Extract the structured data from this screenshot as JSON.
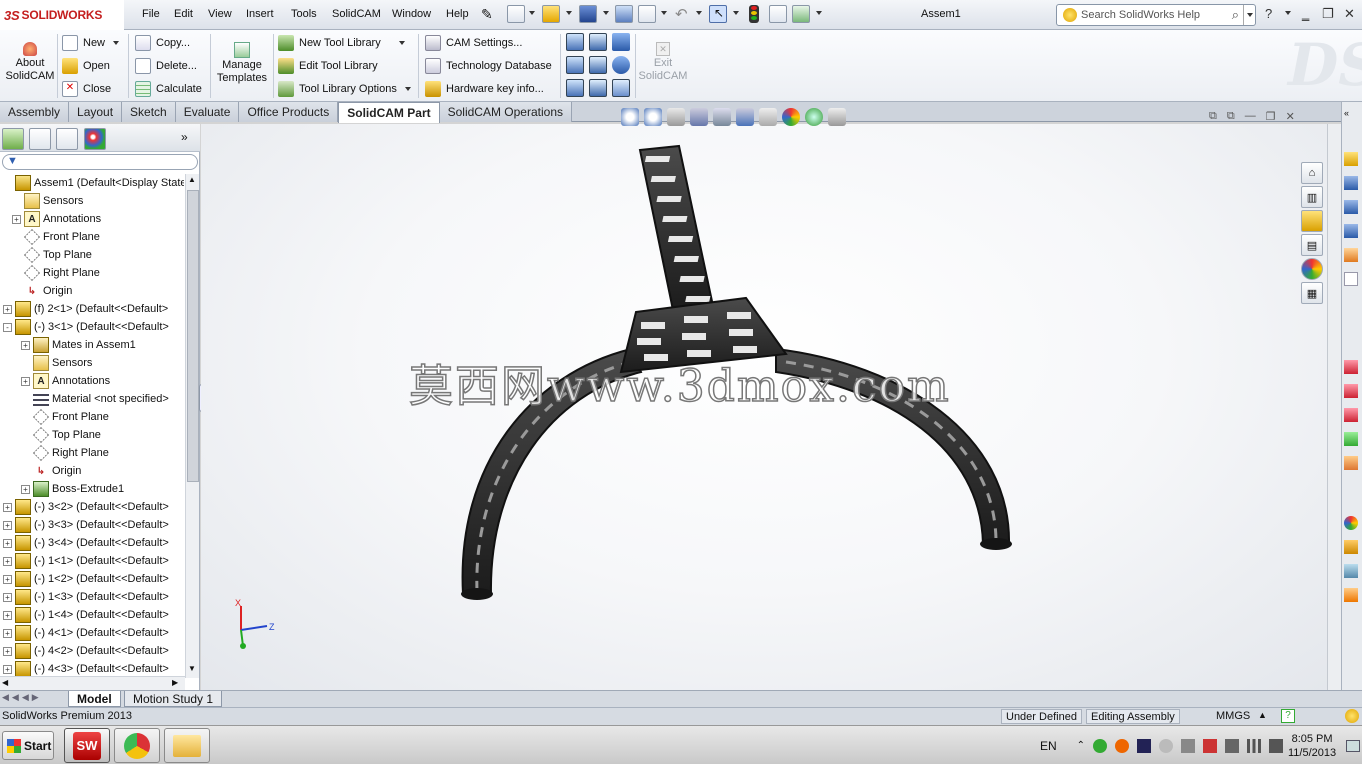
{
  "app": {
    "logo_ds": "3S",
    "logo_name": "SOLIDWORKS",
    "document_title": "Assem1"
  },
  "menu": [
    "File",
    "Edit",
    "View",
    "Insert",
    "Tools",
    "SolidCAM",
    "Window",
    "Help"
  ],
  "search": {
    "placeholder": "Search SolidWorks Help"
  },
  "command_manager": {
    "about": {
      "label1": "About",
      "label2": "SolidCAM"
    },
    "file_group": [
      "New",
      "Open",
      "Close"
    ],
    "edit_group": [
      "Copy...",
      "Delete...",
      "Calculate"
    ],
    "manage_templates": {
      "label1": "Manage",
      "label2": "Templates"
    },
    "tool_group": [
      "New Tool Library",
      "Edit Tool Library",
      "Tool Library Options"
    ],
    "cam_group": [
      "CAM Settings...",
      "Technology Database",
      "Hardware key info..."
    ],
    "exit": {
      "label1": "Exit",
      "label2": "SolidCAM"
    }
  },
  "tabs": [
    {
      "label": "Assembly",
      "active": false
    },
    {
      "label": "Layout",
      "active": false
    },
    {
      "label": "Sketch",
      "active": false
    },
    {
      "label": "Evaluate",
      "active": false
    },
    {
      "label": "Office Products",
      "active": false
    },
    {
      "label": "SolidCAM Part",
      "active": true
    },
    {
      "label": "SolidCAM Operations",
      "active": false
    }
  ],
  "tree": [
    {
      "indent": 0,
      "exp": "",
      "icon": "assembly",
      "label": "Assem1  (Default<Display State-1"
    },
    {
      "indent": 1,
      "exp": "",
      "icon": "sensor",
      "label": "Sensors"
    },
    {
      "indent": 1,
      "exp": "+",
      "icon": "annotation",
      "label": "Annotations"
    },
    {
      "indent": 1,
      "exp": "",
      "icon": "plane",
      "label": "Front Plane"
    },
    {
      "indent": 1,
      "exp": "",
      "icon": "plane",
      "label": "Top Plane"
    },
    {
      "indent": 1,
      "exp": "",
      "icon": "plane",
      "label": "Right Plane"
    },
    {
      "indent": 1,
      "exp": "",
      "icon": "origin",
      "label": "Origin"
    },
    {
      "indent": 0,
      "exp": "+",
      "icon": "part",
      "label": "(f) 2<1> (Default<<Default>"
    },
    {
      "indent": 0,
      "exp": "-",
      "icon": "part",
      "label": "(-) 3<1> (Default<<Default>"
    },
    {
      "indent": 2,
      "exp": "+",
      "icon": "mates",
      "label": "Mates in Assem1"
    },
    {
      "indent": 2,
      "exp": "",
      "icon": "sensor",
      "label": "Sensors"
    },
    {
      "indent": 2,
      "exp": "+",
      "icon": "annotation",
      "label": "Annotations"
    },
    {
      "indent": 2,
      "exp": "",
      "icon": "material",
      "label": "Material <not specified>"
    },
    {
      "indent": 2,
      "exp": "",
      "icon": "plane",
      "label": "Front Plane"
    },
    {
      "indent": 2,
      "exp": "",
      "icon": "plane",
      "label": "Top Plane"
    },
    {
      "indent": 2,
      "exp": "",
      "icon": "plane",
      "label": "Right Plane"
    },
    {
      "indent": 2,
      "exp": "",
      "icon": "origin",
      "label": "Origin"
    },
    {
      "indent": 2,
      "exp": "+",
      "icon": "extrude",
      "label": "Boss-Extrude1"
    },
    {
      "indent": 0,
      "exp": "+",
      "icon": "part",
      "label": "(-) 3<2> (Default<<Default>"
    },
    {
      "indent": 0,
      "exp": "+",
      "icon": "part",
      "label": "(-) 3<3> (Default<<Default>"
    },
    {
      "indent": 0,
      "exp": "+",
      "icon": "part",
      "label": "(-) 3<4> (Default<<Default>"
    },
    {
      "indent": 0,
      "exp": "+",
      "icon": "part",
      "label": "(-) 1<1> (Default<<Default>"
    },
    {
      "indent": 0,
      "exp": "+",
      "icon": "part",
      "label": "(-) 1<2> (Default<<Default>"
    },
    {
      "indent": 0,
      "exp": "+",
      "icon": "part",
      "label": "(-) 1<3> (Default<<Default>"
    },
    {
      "indent": 0,
      "exp": "+",
      "icon": "part",
      "label": "(-) 1<4> (Default<<Default>"
    },
    {
      "indent": 0,
      "exp": "+",
      "icon": "part",
      "label": "(-) 4<1> (Default<<Default>"
    },
    {
      "indent": 0,
      "exp": "+",
      "icon": "part",
      "label": "(-) 4<2> (Default<<Default>"
    },
    {
      "indent": 0,
      "exp": "+",
      "icon": "part",
      "label": "(-) 4<3> (Default<<Default>"
    }
  ],
  "viewport": {
    "watermark": "莫西网www.3dmox.com",
    "triad_x": "X",
    "triad_z": "Z"
  },
  "bottom_tabs": [
    "Model",
    "Motion Study 1"
  ],
  "status": {
    "product": "SolidWorks Premium 2013",
    "state": "Under Defined",
    "mode": "Editing Assembly",
    "units": "MMGS"
  },
  "taskbar": {
    "start": "Start",
    "lang": "EN",
    "time": "8:05 PM",
    "date": "11/5/2013"
  }
}
